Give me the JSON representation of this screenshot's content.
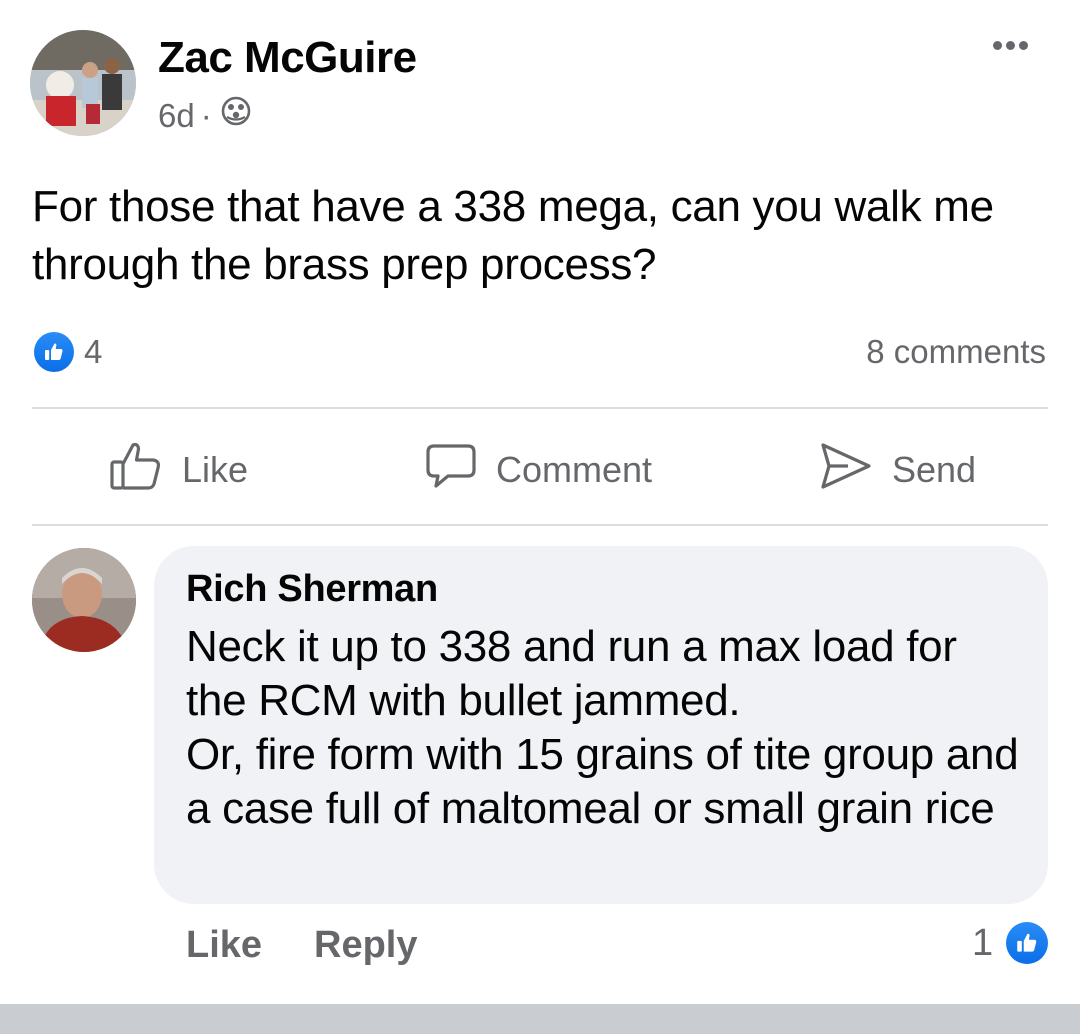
{
  "post": {
    "author": "Zac McGuire",
    "timestamp": "6d",
    "separator": "·",
    "privacy_icon": "group-icon",
    "text": "For those that have a 338 mega, can you walk me through the brass prep process?",
    "reaction_count": "4",
    "comments_count": "8 comments"
  },
  "actions": {
    "like": "Like",
    "comment": "Comment",
    "send": "Send"
  },
  "comment": {
    "author": "Rich Sherman",
    "text": "Neck it up to 338 and run a max load for the RCM with bullet jammed.\nOr, fire form with 15 grains of tite group and a case full of maltomeal or small grain rice",
    "like_label": "Like",
    "reply_label": "Reply",
    "reaction_count": "1"
  },
  "colors": {
    "accent": "#1877f2",
    "secondary_text": "#65676b",
    "bubble": "#f0f2f5"
  }
}
